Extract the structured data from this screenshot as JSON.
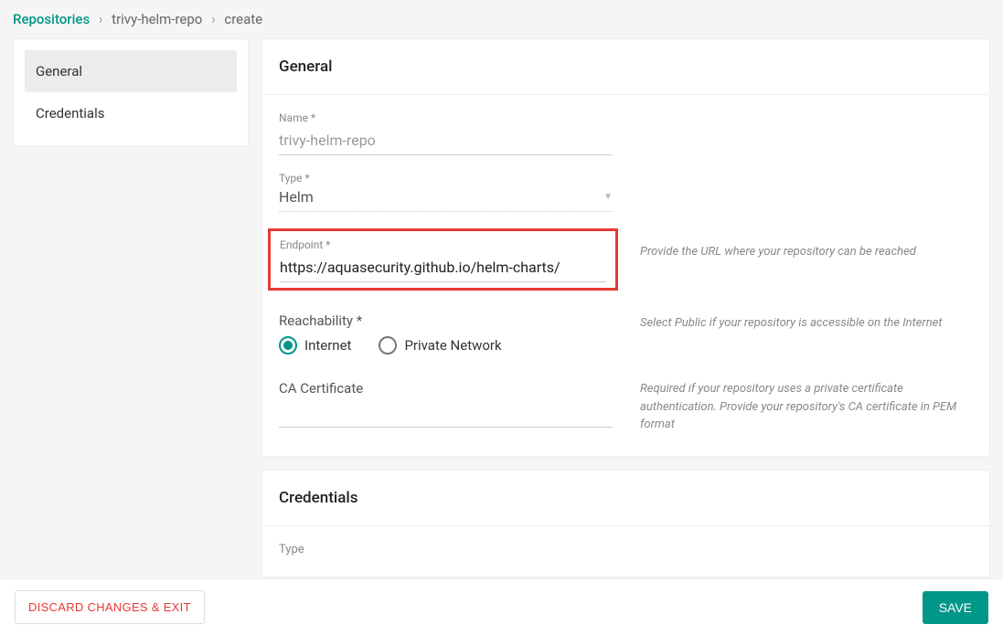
{
  "breadcrumb": {
    "root": "Repositories",
    "item1": "trivy-helm-repo",
    "item2": "create"
  },
  "sidebar": {
    "items": [
      {
        "label": "General",
        "active": true
      },
      {
        "label": "Credentials",
        "active": false
      }
    ]
  },
  "general": {
    "title": "General",
    "name_label": "Name *",
    "name_value": "trivy-helm-repo",
    "type_label": "Type *",
    "type_value": "Helm",
    "endpoint_label": "Endpoint *",
    "endpoint_value": "https://aquasecurity.github.io/helm-charts/",
    "endpoint_hint": "Provide the URL where your repository can be reached",
    "reachability_label": "Reachability *",
    "reachability_hint": "Select Public if your repository is accessible on the Internet",
    "reachability_options": {
      "internet": "Internet",
      "private": "Private Network"
    },
    "ca_label": "CA Certificate",
    "ca_hint": "Required if your repository uses a private certificate authentication. Provide your repository's CA certificate in PEM format"
  },
  "credentials": {
    "title": "Credentials",
    "type_label": "Type"
  },
  "footer": {
    "discard": "DISCARD CHANGES & EXIT",
    "save": "SAVE"
  }
}
